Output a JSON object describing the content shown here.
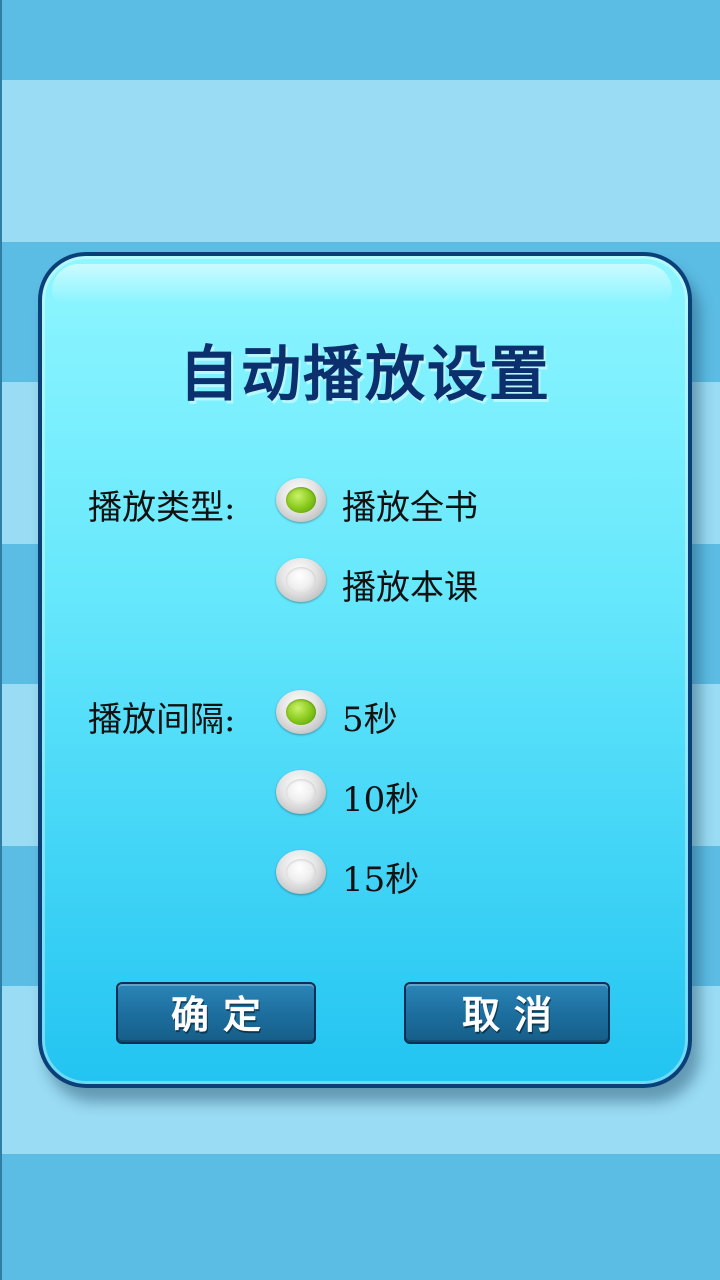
{
  "dialog": {
    "title": "自动播放设置",
    "play_type": {
      "label": "播放类型:",
      "options": [
        {
          "text": "播放全书",
          "checked": true
        },
        {
          "text": "播放本课",
          "checked": false
        }
      ]
    },
    "play_interval": {
      "label": "播放间隔:",
      "options": [
        {
          "text": "5秒",
          "checked": true
        },
        {
          "text": "10秒",
          "checked": false
        },
        {
          "text": "15秒",
          "checked": false
        }
      ]
    },
    "confirm_label": "确定",
    "cancel_label": "取消"
  },
  "colors": {
    "stripe_dark": "#5cbde4",
    "stripe_light": "#9adcf3",
    "dialog_border": "#0b3f78",
    "title": "#0c2f6e",
    "button": "#1d6f9f",
    "radio_selected": "#8acb1d"
  }
}
